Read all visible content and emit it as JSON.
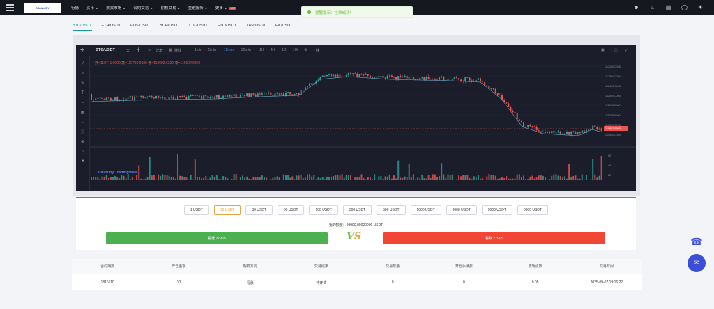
{
  "nav": {
    "items": [
      "行情",
      "买币 ⌄",
      "期货市场 ⌄",
      "合约交易 ⌄",
      "期权交易 ⌄",
      "金融服务 ⌄",
      "更多 ⌄"
    ],
    "hot_badge": "HOT",
    "logo_text": "DANAKEY"
  },
  "toast": {
    "text": "提醒提示：挂单成功!"
  },
  "pairs": [
    "BTC/USDT",
    "ETH/USDT",
    "EOS/USDT",
    "BCH/USDT",
    "LTC/USDT",
    "ETC/USDT",
    "XRP/USDT",
    "FIL/USDT"
  ],
  "active_pair": "BTC/USDT",
  "chart": {
    "symbol": "BTC/USDT",
    "timeframes": [
      "天",
      "比較",
      "横线",
      "1min",
      "5min",
      "15min",
      "30min",
      "1H",
      "4H",
      "1D",
      "1W"
    ],
    "active_timeframe": "15min",
    "ohlc": {
      "open_label": "开",
      "open": "110741.0000",
      "high_label": "高",
      "high": "110750.0100",
      "low_label": "低",
      "low": "110692.6300",
      "close_label": "收",
      "close": "110692.6300"
    },
    "price_ticks": [
      "113200.0000",
      "112800.0000",
      "112400.0000",
      "112000.0000",
      "111600.0000",
      "111200.0000",
      "110800.0000",
      "110400.0000"
    ],
    "current_price": "110692.6300",
    "volume_ticks": [
      "60",
      "40",
      "20"
    ],
    "tv_logo": "Chart by TradingView"
  },
  "amounts": [
    "1 USDT",
    "10 USDT",
    "30 USDT",
    "50 USDT",
    "100 USDT",
    "300 USDT",
    "500 USDT",
    "1000 USDT",
    "3000 USDT",
    "5000 USDT",
    "8000 USDT"
  ],
  "selected_amount": "10 USDT",
  "balance": "我的额度：99990.00000000 USDT",
  "buy_label": "看涨 2790S",
  "sell_label": "看跌 2790S",
  "vs": {
    "v": "V",
    "s": "S"
  },
  "table": {
    "headers": [
      "合约期数",
      "开仓金额",
      "期权方向",
      "交易结果",
      "交易数量",
      "开仓手续费",
      "波场点数",
      "交易时间"
    ],
    "rows": [
      [
        "1816110",
        "10",
        "看涨",
        "待开奖",
        "0",
        "0",
        "0.05",
        "2025-09-07 19:16:22"
      ]
    ]
  },
  "colors": {
    "up": "#26a69a",
    "down": "#ef5350",
    "accent": "#1a9e8f",
    "buy": "#4caf50",
    "sell": "#f14536"
  }
}
